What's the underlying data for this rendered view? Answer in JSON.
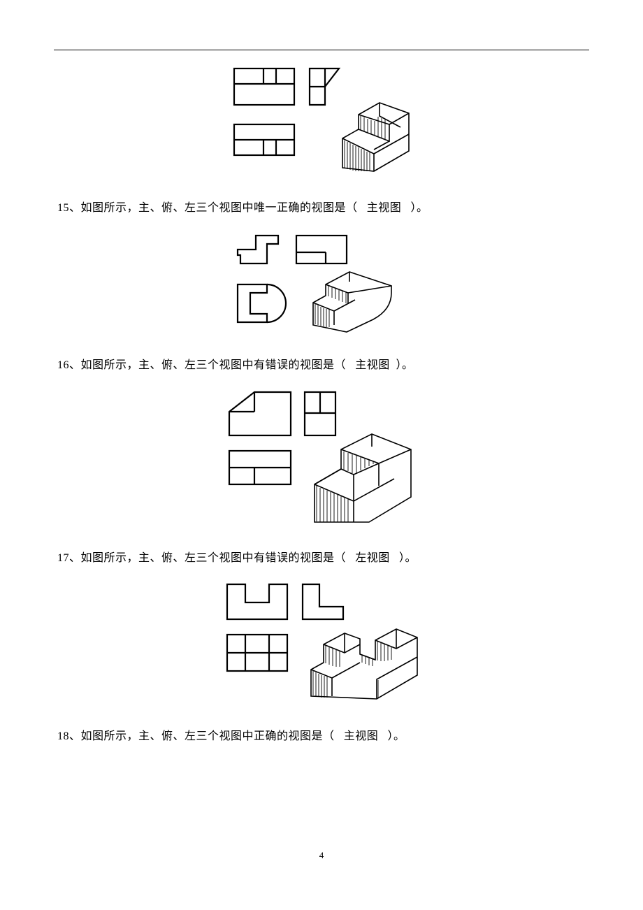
{
  "page_number": "4",
  "questions": [
    {
      "num": "15",
      "prefix": "、如图所示，主、俯、左三个视图中唯一正确的视图是（",
      "answer": "主视图",
      "suffix": "）。"
    },
    {
      "num": "16",
      "prefix": "、如图所示，主、俯、左三个视图中有错误的视图是（",
      "answer": "主视图",
      "suffix": "）。"
    },
    {
      "num": "17",
      "prefix": "、如图所示，主、俯、左三个视图中有错误的视图是（",
      "answer": "左视图",
      "suffix": "）。"
    },
    {
      "num": "18",
      "prefix": "、如图所示，主、俯、左三个视图中正确的视图是（",
      "answer": "主视图",
      "suffix": "）。"
    }
  ]
}
